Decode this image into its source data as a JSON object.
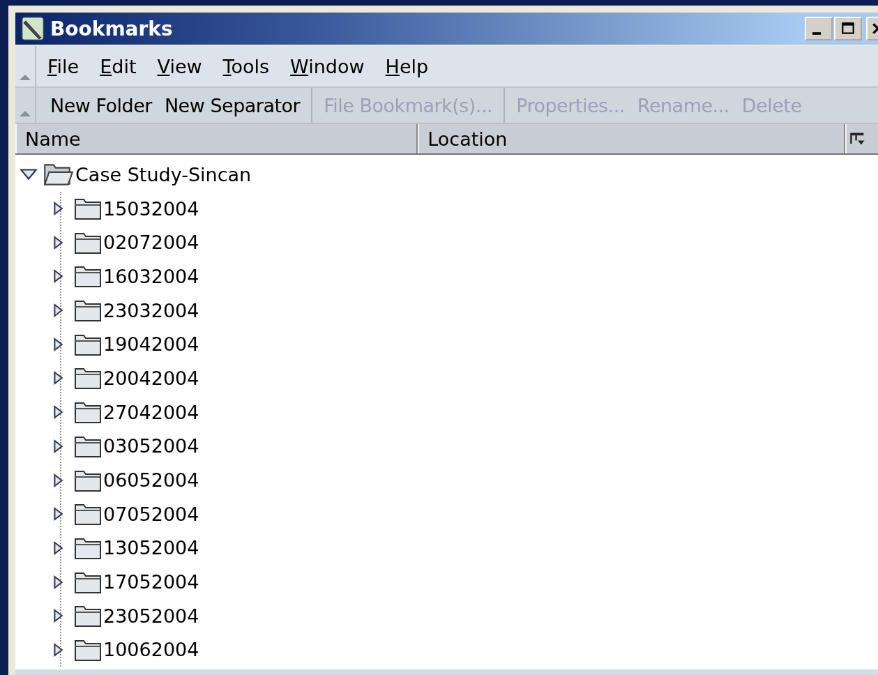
{
  "window": {
    "title": "Bookmarks"
  },
  "menu": [
    {
      "label": "File"
    },
    {
      "label": "Edit"
    },
    {
      "label": "View"
    },
    {
      "label": "Tools"
    },
    {
      "label": "Window"
    },
    {
      "label": "Help"
    }
  ],
  "toolbar": [
    {
      "group": [
        {
          "label": "New Folder",
          "disabled": false
        },
        {
          "label": "New Separator",
          "disabled": false
        }
      ]
    },
    {
      "group": [
        {
          "label": "File Bookmark(s)...",
          "disabled": true
        }
      ]
    },
    {
      "group": [
        {
          "label": "Properties...",
          "disabled": true
        },
        {
          "label": "Rename...",
          "disabled": true
        },
        {
          "label": "Delete",
          "disabled": true
        }
      ]
    }
  ],
  "table": {
    "columns": [
      "Name",
      "Location"
    ]
  },
  "tree": [
    {
      "label": "Case Study-Sincan",
      "expanded": true,
      "children": [
        {
          "label": "15032004",
          "expanded": false
        },
        {
          "label": "02072004",
          "expanded": false
        },
        {
          "label": "16032004",
          "expanded": false
        },
        {
          "label": "23032004",
          "expanded": false
        },
        {
          "label": "19042004",
          "expanded": false
        },
        {
          "label": "20042004",
          "expanded": false
        },
        {
          "label": "27042004",
          "expanded": false
        },
        {
          "label": "03052004",
          "expanded": false
        },
        {
          "label": "06052004",
          "expanded": false
        },
        {
          "label": "07052004",
          "expanded": false
        },
        {
          "label": "13052004",
          "expanded": false
        },
        {
          "label": "17052004",
          "expanded": false
        },
        {
          "label": "23052004",
          "expanded": false
        },
        {
          "label": "10062004",
          "expanded": false
        }
      ]
    }
  ]
}
